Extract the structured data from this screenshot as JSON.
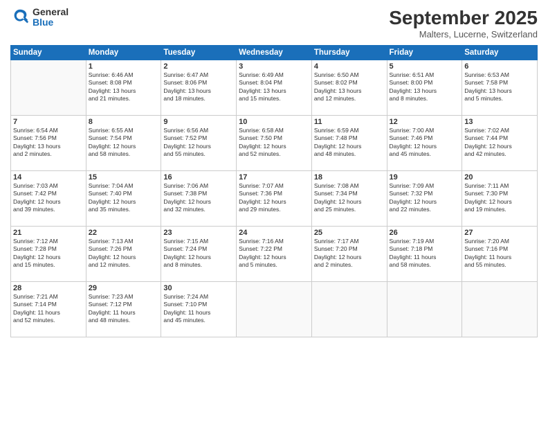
{
  "header": {
    "logo_general": "General",
    "logo_blue": "Blue",
    "month_title": "September 2025",
    "location": "Malters, Lucerne, Switzerland"
  },
  "days_of_week": [
    "Sunday",
    "Monday",
    "Tuesday",
    "Wednesday",
    "Thursday",
    "Friday",
    "Saturday"
  ],
  "weeks": [
    [
      {
        "day": "",
        "info": ""
      },
      {
        "day": "1",
        "info": "Sunrise: 6:46 AM\nSunset: 8:08 PM\nDaylight: 13 hours\nand 21 minutes."
      },
      {
        "day": "2",
        "info": "Sunrise: 6:47 AM\nSunset: 8:06 PM\nDaylight: 13 hours\nand 18 minutes."
      },
      {
        "day": "3",
        "info": "Sunrise: 6:49 AM\nSunset: 8:04 PM\nDaylight: 13 hours\nand 15 minutes."
      },
      {
        "day": "4",
        "info": "Sunrise: 6:50 AM\nSunset: 8:02 PM\nDaylight: 13 hours\nand 12 minutes."
      },
      {
        "day": "5",
        "info": "Sunrise: 6:51 AM\nSunset: 8:00 PM\nDaylight: 13 hours\nand 8 minutes."
      },
      {
        "day": "6",
        "info": "Sunrise: 6:53 AM\nSunset: 7:58 PM\nDaylight: 13 hours\nand 5 minutes."
      }
    ],
    [
      {
        "day": "7",
        "info": "Sunrise: 6:54 AM\nSunset: 7:56 PM\nDaylight: 13 hours\nand 2 minutes."
      },
      {
        "day": "8",
        "info": "Sunrise: 6:55 AM\nSunset: 7:54 PM\nDaylight: 12 hours\nand 58 minutes."
      },
      {
        "day": "9",
        "info": "Sunrise: 6:56 AM\nSunset: 7:52 PM\nDaylight: 12 hours\nand 55 minutes."
      },
      {
        "day": "10",
        "info": "Sunrise: 6:58 AM\nSunset: 7:50 PM\nDaylight: 12 hours\nand 52 minutes."
      },
      {
        "day": "11",
        "info": "Sunrise: 6:59 AM\nSunset: 7:48 PM\nDaylight: 12 hours\nand 48 minutes."
      },
      {
        "day": "12",
        "info": "Sunrise: 7:00 AM\nSunset: 7:46 PM\nDaylight: 12 hours\nand 45 minutes."
      },
      {
        "day": "13",
        "info": "Sunrise: 7:02 AM\nSunset: 7:44 PM\nDaylight: 12 hours\nand 42 minutes."
      }
    ],
    [
      {
        "day": "14",
        "info": "Sunrise: 7:03 AM\nSunset: 7:42 PM\nDaylight: 12 hours\nand 39 minutes."
      },
      {
        "day": "15",
        "info": "Sunrise: 7:04 AM\nSunset: 7:40 PM\nDaylight: 12 hours\nand 35 minutes."
      },
      {
        "day": "16",
        "info": "Sunrise: 7:06 AM\nSunset: 7:38 PM\nDaylight: 12 hours\nand 32 minutes."
      },
      {
        "day": "17",
        "info": "Sunrise: 7:07 AM\nSunset: 7:36 PM\nDaylight: 12 hours\nand 29 minutes."
      },
      {
        "day": "18",
        "info": "Sunrise: 7:08 AM\nSunset: 7:34 PM\nDaylight: 12 hours\nand 25 minutes."
      },
      {
        "day": "19",
        "info": "Sunrise: 7:09 AM\nSunset: 7:32 PM\nDaylight: 12 hours\nand 22 minutes."
      },
      {
        "day": "20",
        "info": "Sunrise: 7:11 AM\nSunset: 7:30 PM\nDaylight: 12 hours\nand 19 minutes."
      }
    ],
    [
      {
        "day": "21",
        "info": "Sunrise: 7:12 AM\nSunset: 7:28 PM\nDaylight: 12 hours\nand 15 minutes."
      },
      {
        "day": "22",
        "info": "Sunrise: 7:13 AM\nSunset: 7:26 PM\nDaylight: 12 hours\nand 12 minutes."
      },
      {
        "day": "23",
        "info": "Sunrise: 7:15 AM\nSunset: 7:24 PM\nDaylight: 12 hours\nand 8 minutes."
      },
      {
        "day": "24",
        "info": "Sunrise: 7:16 AM\nSunset: 7:22 PM\nDaylight: 12 hours\nand 5 minutes."
      },
      {
        "day": "25",
        "info": "Sunrise: 7:17 AM\nSunset: 7:20 PM\nDaylight: 12 hours\nand 2 minutes."
      },
      {
        "day": "26",
        "info": "Sunrise: 7:19 AM\nSunset: 7:18 PM\nDaylight: 11 hours\nand 58 minutes."
      },
      {
        "day": "27",
        "info": "Sunrise: 7:20 AM\nSunset: 7:16 PM\nDaylight: 11 hours\nand 55 minutes."
      }
    ],
    [
      {
        "day": "28",
        "info": "Sunrise: 7:21 AM\nSunset: 7:14 PM\nDaylight: 11 hours\nand 52 minutes."
      },
      {
        "day": "29",
        "info": "Sunrise: 7:23 AM\nSunset: 7:12 PM\nDaylight: 11 hours\nand 48 minutes."
      },
      {
        "day": "30",
        "info": "Sunrise: 7:24 AM\nSunset: 7:10 PM\nDaylight: 11 hours\nand 45 minutes."
      },
      {
        "day": "",
        "info": ""
      },
      {
        "day": "",
        "info": ""
      },
      {
        "day": "",
        "info": ""
      },
      {
        "day": "",
        "info": ""
      }
    ]
  ]
}
